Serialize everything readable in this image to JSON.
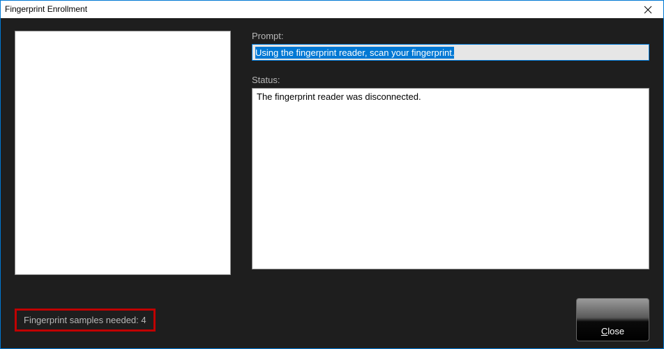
{
  "window": {
    "title": "Fingerprint Enrollment"
  },
  "prompt": {
    "label": "Prompt:",
    "value": "Using the fingerprint reader, scan your fingerprint."
  },
  "status": {
    "label": "Status:",
    "value": "The fingerprint reader was disconnected."
  },
  "samples": {
    "label": "Fingerprint samples needed:",
    "count": "4"
  },
  "buttons": {
    "close_prefix": "C",
    "close_rest": "lose"
  }
}
